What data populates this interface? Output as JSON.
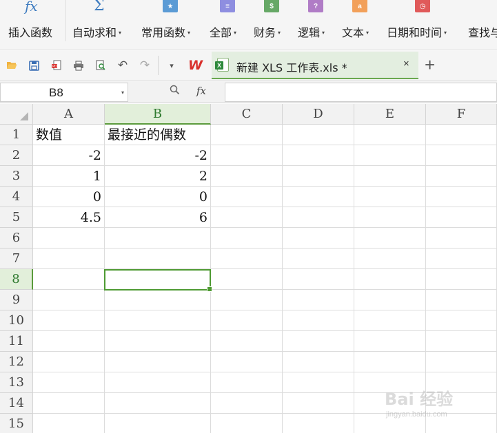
{
  "ribbon": {
    "buttons": [
      {
        "label": "插入函数",
        "icon": "fx-icon",
        "arrow": ""
      },
      {
        "label": "自动求和",
        "icon": "sigma-icon",
        "arrow": "▾"
      },
      {
        "label": "常用函数",
        "icon": "star-book-icon",
        "arrow": "▾"
      },
      {
        "label": "全部",
        "icon": "list-book-icon",
        "arrow": "▾"
      },
      {
        "label": "财务",
        "icon": "money-book-icon",
        "arrow": "▾"
      },
      {
        "label": "逻辑",
        "icon": "question-book-icon",
        "arrow": "▾"
      },
      {
        "label": "文本",
        "icon": "text-book-icon",
        "arrow": "▾"
      },
      {
        "label": "日期和时间",
        "icon": "clock-book-icon",
        "arrow": "▾"
      },
      {
        "label": "查找与",
        "icon": "",
        "arrow": ""
      }
    ],
    "icon_glyphs": {
      "fx": "fx",
      "sum": "Σ",
      "star": "★",
      "list": "≡",
      "money": "$",
      "question": "?",
      "text": "a",
      "clock": "◷"
    },
    "colors": {
      "star": "#5b9bd5",
      "list": "#8e8ee0",
      "money": "#66a866",
      "question": "#b07cc6",
      "text": "#f2a05a",
      "clock": "#e05a5a"
    }
  },
  "quickaccess": {
    "icons": [
      "open-folder-icon",
      "save-icon",
      "export-pdf-icon",
      "print-icon",
      "print-preview-icon",
      "undo-icon",
      "redo-icon",
      "dropdown-icon"
    ],
    "glyphs": {
      "open": "📂",
      "save": "💾",
      "pdf": "⎘",
      "print": "⎙",
      "preview": "🔍",
      "undo": "↶",
      "redo": "↷",
      "dropdown": "▾"
    }
  },
  "app": {
    "logo_text": "W"
  },
  "tab": {
    "title": "新建 XLS 工作表.xls *",
    "close": "×",
    "add": "+"
  },
  "namebox": {
    "value": "B8",
    "dropdown": "▾"
  },
  "formulabar": {
    "zoom": "🔍",
    "fx": "fx",
    "value": ""
  },
  "sheet": {
    "columns": [
      "A",
      "B",
      "C",
      "D",
      "E",
      "F"
    ],
    "rows": [
      "1",
      "2",
      "3",
      "4",
      "5",
      "6",
      "7",
      "8",
      "9",
      "10",
      "11",
      "12",
      "13",
      "14",
      "15"
    ],
    "active_cell": "B8",
    "cells": {
      "A1": "数值",
      "B1": "最接近的偶数",
      "A2": "-2",
      "B2": "-2",
      "A3": "1",
      "B3": "2",
      "A4": "0",
      "B4": "0",
      "A5": "4.5",
      "B5": "6"
    },
    "accent": "#4e9a32"
  },
  "watermark": {
    "main": "Bai 经验",
    "sub": "jingyan.baidu.com"
  }
}
